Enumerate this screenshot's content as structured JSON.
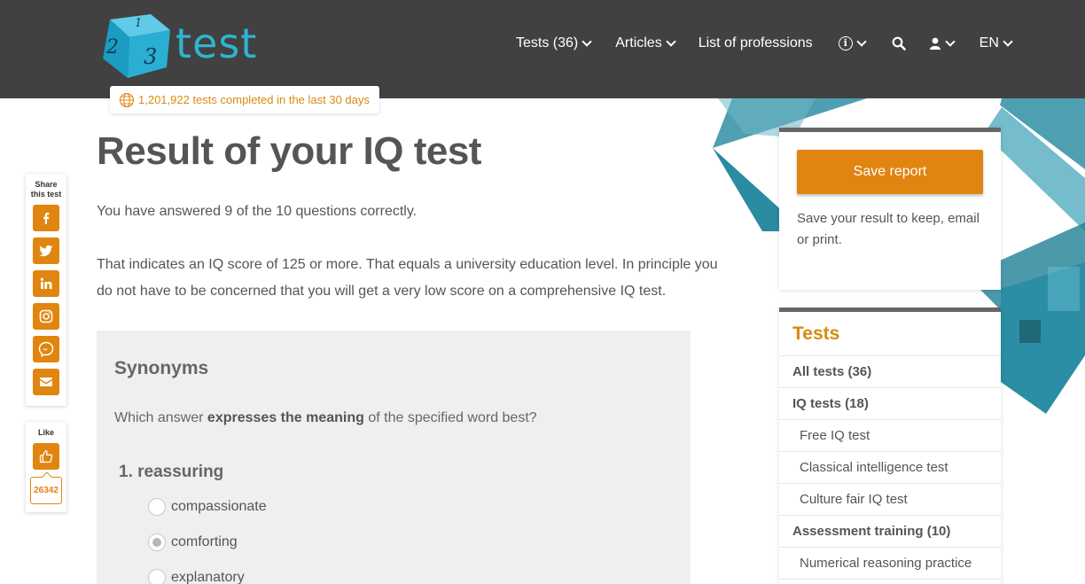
{
  "header": {
    "logo_text": "test",
    "nav": [
      {
        "label": "Tests (36)"
      },
      {
        "label": "Articles"
      },
      {
        "label": "List of professions"
      }
    ],
    "language": "EN"
  },
  "counter": {
    "text": "1,201,922 tests completed in the last 30 days"
  },
  "main": {
    "title": "Result of your IQ test",
    "answered_text": "You have answered 9 of the 10 questions correctly.",
    "score_text": "That indicates an IQ score of 125 or more. That equals a university education level. In principle you do not have to be concerned that you will get a very low score on a comprehensive IQ test."
  },
  "question": {
    "section_title": "Synonyms",
    "desc_pre": "Which answer ",
    "desc_bold": "expresses the meaning",
    "desc_post": " of the specified word best?",
    "number_label": "1. reassuring",
    "options": [
      {
        "label": "compassionate",
        "selected": false
      },
      {
        "label": "comforting",
        "selected": true
      },
      {
        "label": "explanatory",
        "selected": false
      }
    ]
  },
  "share": {
    "label_line1": "Share",
    "label_line2": "this test",
    "buttons": [
      "facebook-icon",
      "twitter-icon",
      "linkedin-icon",
      "instagram-icon",
      "messenger-icon",
      "email-icon"
    ],
    "like_label": "Like",
    "like_count": "26342"
  },
  "save_card": {
    "button_label": "Save report",
    "description": "Save your result to keep, email or print."
  },
  "tests_card": {
    "heading": "Tests",
    "items": [
      {
        "label": "All tests (36)",
        "type": "cat"
      },
      {
        "label": "IQ tests (18)",
        "type": "cat"
      },
      {
        "label": "Free IQ test",
        "type": "sub"
      },
      {
        "label": "Classical intelligence test",
        "type": "sub"
      },
      {
        "label": "Culture fair IQ test",
        "type": "sub"
      },
      {
        "label": "Assessment training (10)",
        "type": "cat"
      },
      {
        "label": "Numerical reasoning practice",
        "type": "sub"
      }
    ]
  },
  "colors": {
    "accent": "#e08510",
    "header_bg": "#414141",
    "brand_blue": "#2fb3cf",
    "link_orange": "#d98a12"
  }
}
